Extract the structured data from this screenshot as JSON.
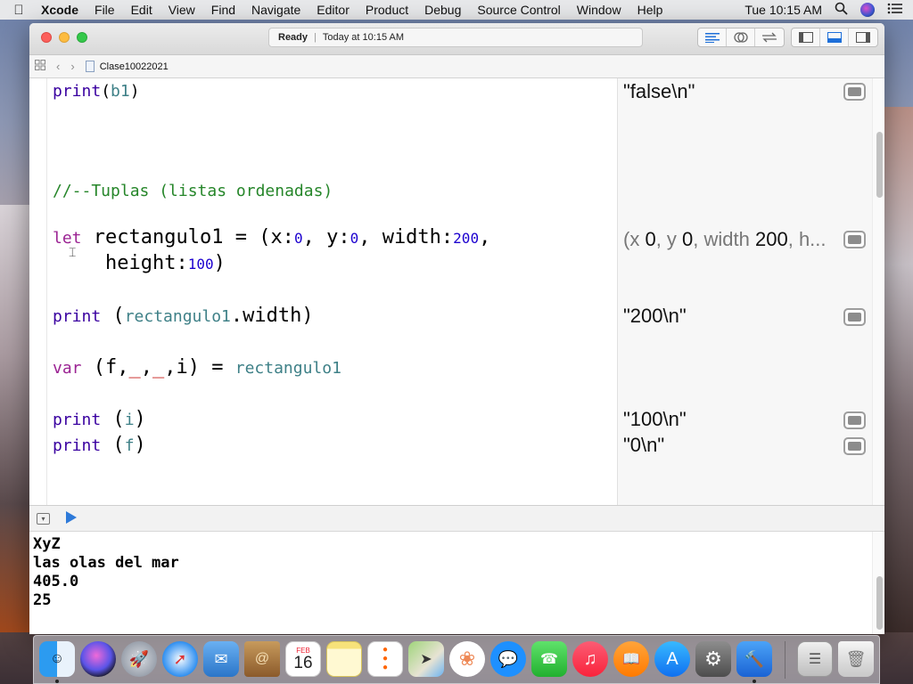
{
  "menubar": {
    "apple_icon": "apple-icon",
    "items": [
      "Xcode",
      "File",
      "Edit",
      "View",
      "Find",
      "Navigate",
      "Editor",
      "Product",
      "Debug",
      "Source Control",
      "Window",
      "Help"
    ],
    "clock": "Tue 10:15 AM"
  },
  "window": {
    "activity": {
      "status": "Ready",
      "time": "Today at 10:15 AM"
    },
    "jumpbar": {
      "file": "Clase10022021"
    }
  },
  "code": {
    "line_print_b1": {
      "kw": "print",
      "open": "(",
      "arg": "b1",
      "close": ")"
    },
    "comment": "//--Tuplas (listas ordenadas)",
    "let_line": {
      "kw": "let",
      "name": " rectangulo1 = (x:",
      "x": "0",
      "mid1": ", y:",
      "y": "0",
      "mid2": ", width:",
      "width": "200",
      "end1": ",",
      "cont": "height:",
      "height": "100",
      "end2": ")"
    },
    "print_width": {
      "kw": "print",
      "open": " (",
      "arg": "rectangulo1",
      "rest": ".width)"
    },
    "var_line": {
      "kw": "var",
      "a": " (f,",
      "u1": "_",
      "c1": ",",
      "u2": "_",
      "b": ",i) = ",
      "rhs": "rectangulo1"
    },
    "print_i": {
      "kw": "print",
      "open": " (",
      "arg": "i",
      "close": ")"
    },
    "print_f": {
      "kw": "print",
      "open": " (",
      "arg": "f",
      "close": ")"
    }
  },
  "results": {
    "r1": "\"false\\n\"",
    "r2_a": "(x ",
    "r2_b": "0",
    "r2_c": ", y ",
    "r2_d": "0",
    "r2_e": ", width ",
    "r2_f": "200",
    "r2_g": ", h...",
    "r3": "\"200\\n\"",
    "r4": "\"100\\n\"",
    "r5": "\"0\\n\""
  },
  "console": {
    "lines": [
      "XyZ",
      "las olas del mar",
      "405.0",
      "25"
    ]
  },
  "dock": {
    "apps": [
      "Finder",
      "Siri",
      "Launchpad",
      "Safari",
      "Mail",
      "Contacts",
      "Calendar",
      "Notes",
      "Reminders",
      "Maps",
      "Photos",
      "Messages",
      "FaceTime",
      "iTunes",
      "iBooks",
      "App Store",
      "System Preferences",
      "Xcode",
      "Documents",
      "Trash"
    ],
    "calendar_month": "FEB",
    "calendar_day": "16"
  },
  "colors": {
    "keyword": "#9b2393",
    "function": "#3900a0",
    "variable": "#3e8087",
    "number": "#1c00cf",
    "comment": "#26862a"
  }
}
